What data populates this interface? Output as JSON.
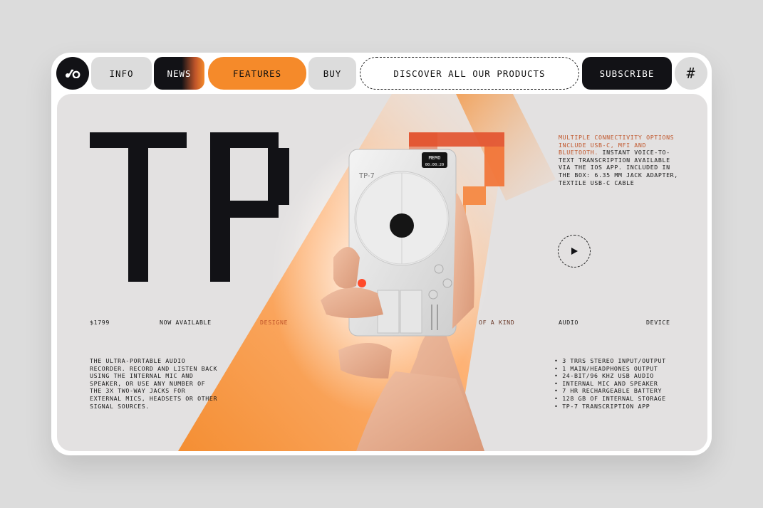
{
  "nav": {
    "logo_icon": "teenage-engineering-logo-icon",
    "info": "INFO",
    "news": "NEWS",
    "features": "FEATURES",
    "buy": "BUY",
    "discover": "DISCOVER ALL OUR PRODUCTS",
    "subscribe": "SUBSCRIBE",
    "hash": "#"
  },
  "hero": {
    "title": "TP-7",
    "price": "$1799",
    "availability": "NOW AVAILABLE",
    "tagline_part1": "DESIGNE",
    "tagline_part2": "OF A KIND",
    "tag_audio": "AUDIO",
    "tag_device": "DEVICE",
    "description": "THE ULTRA-PORTABLE AUDIO RECORDER. RECORD AND LISTEN BACK USING THE INTERNAL MIC AND SPEAKER, OR USE ANY NUMBER OF THE 3X TWO-WAY JACKS FOR EXTERNAL MICS, HEADSETS OR OTHER SIGNAL SOURCES.",
    "connectivity_highlight": "MULTIPLE CONNECTIVITY OPTIONS INCLUDE USB-C, MFI AND BLUETOOTH.",
    "connectivity_rest": " INSTANT VOICE-TO-TEXT TRANSCRIPTION AVAILABLE VIA THE IOS APP. INCLUDED IN THE BOX: 6.35 MM JACK ADAPTER, TEXTILE USB-C CABLE",
    "specs": [
      "• 3 TRRS STEREO INPUT/OUTPUT",
      "• 1 MAIN/HEADPHONES OUTPUT",
      "• 24-BIT/96 KHZ USB AUDIO",
      "• INTERNAL MIC AND SPEAKER",
      "• 7 HR RECHARGEABLE BATTERY",
      "• 128 GB OF INTERNAL STORAGE",
      "• TP-7 TRANSCRIPTION APP"
    ],
    "device_label": "TP-7",
    "device_screen_label": "MEMO",
    "device_screen_time": "00:00:20",
    "play_icon": "play-icon",
    "accent_color": "#f58a2a"
  }
}
